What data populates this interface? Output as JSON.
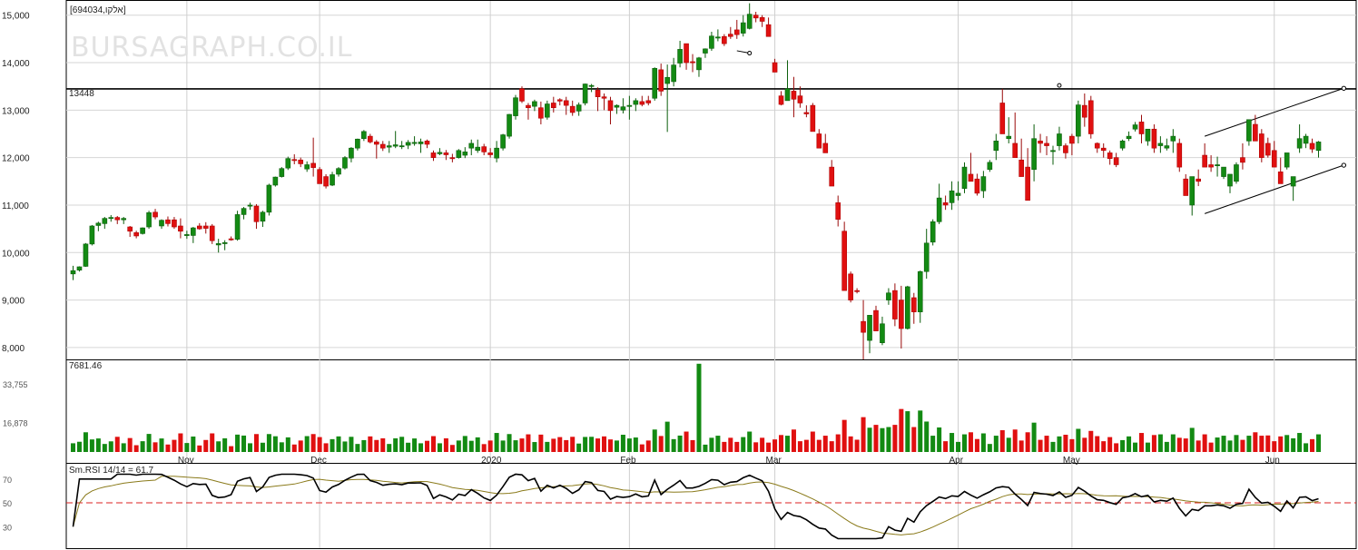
{
  "chart_data": {
    "type": "candlestick",
    "ticker_label": "[אלקו,694034]",
    "watermark": "BURSAGRAPH.CO.IL",
    "price_axis": {
      "ylim": [
        7750,
        15300
      ],
      "ticks": [
        8000,
        9000,
        10000,
        11000,
        12000,
        13000,
        14000,
        15000
      ],
      "tick_labels": [
        "8,000",
        "9,000",
        "10,000",
        "11,000",
        "12,000",
        "13,000",
        "14,000",
        "15,000"
      ]
    },
    "resistance": {
      "label": "13448",
      "value": 13448
    },
    "volume_axis": {
      "ymax": 40000,
      "ticks": [
        "33,755",
        "16,878"
      ],
      "tick_values": [
        33755,
        16878
      ],
      "label": "7681.46"
    },
    "rsi": {
      "label": "Sm.RSI 14/14 = 61.7",
      "ticks": [
        "70",
        "50",
        "30"
      ],
      "tick_values": [
        70,
        50,
        30
      ],
      "reference": 50,
      "ylim": [
        12,
        82
      ]
    },
    "x_months": [
      "Nov",
      "Dec",
      "2020",
      "Feb",
      "Mar",
      "Apr",
      "May",
      "Jun"
    ],
    "candles": [
      [
        9550,
        9720,
        9420,
        9620
      ],
      [
        9630,
        9710,
        9600,
        9700
      ],
      [
        9710,
        10200,
        9700,
        10180
      ],
      [
        10180,
        10580,
        10150,
        10560
      ],
      [
        10570,
        10650,
        10450,
        10620
      ],
      [
        10610,
        10750,
        10500,
        10720
      ],
      [
        10720,
        10790,
        10650,
        10740
      ],
      [
        10740,
        10770,
        10600,
        10690
      ],
      [
        10690,
        10750,
        10600,
        10720
      ],
      [
        10540,
        10560,
        10330,
        10450
      ],
      [
        10420,
        10460,
        10300,
        10350
      ],
      [
        10400,
        10530,
        10380,
        10520
      ],
      [
        10540,
        10880,
        10500,
        10840
      ],
      [
        10850,
        10920,
        10700,
        10750
      ],
      [
        10560,
        10700,
        10500,
        10680
      ],
      [
        10690,
        10760,
        10550,
        10610
      ],
      [
        10690,
        10750,
        10500,
        10540
      ],
      [
        10560,
        10720,
        10300,
        10450
      ],
      [
        10380,
        10460,
        10290,
        10380
      ],
      [
        10360,
        10540,
        10200,
        10520
      ],
      [
        10560,
        10620,
        10480,
        10500
      ],
      [
        10560,
        10640,
        10400,
        10510
      ],
      [
        10560,
        10600,
        10180,
        10250
      ],
      [
        10160,
        10290,
        10000,
        10190
      ],
      [
        10200,
        10260,
        10050,
        10210
      ],
      [
        10290,
        10340,
        10250,
        10280
      ],
      [
        10280,
        10880,
        10250,
        10800
      ],
      [
        10800,
        10960,
        10700,
        10930
      ],
      [
        10980,
        11050,
        10900,
        11000
      ],
      [
        10980,
        11020,
        10500,
        10650
      ],
      [
        10660,
        10880,
        10540,
        10850
      ],
      [
        10850,
        11450,
        10780,
        11420
      ],
      [
        11420,
        11600,
        11390,
        11590
      ],
      [
        11600,
        11800,
        11580,
        11770
      ],
      [
        11780,
        12020,
        11740,
        11980
      ],
      [
        11960,
        12070,
        11860,
        11940
      ],
      [
        11950,
        12000,
        11800,
        11870
      ],
      [
        11760,
        11920,
        11700,
        11850
      ],
      [
        11880,
        12420,
        11600,
        11790
      ],
      [
        11750,
        11800,
        11500,
        11450
      ],
      [
        11600,
        11650,
        11350,
        11400
      ],
      [
        11420,
        11700,
        11400,
        11640
      ],
      [
        11650,
        11800,
        11600,
        11770
      ],
      [
        11780,
        12030,
        11750,
        12000
      ],
      [
        11990,
        12220,
        11900,
        12200
      ],
      [
        12200,
        12400,
        12150,
        12390
      ],
      [
        12400,
        12580,
        12350,
        12550
      ],
      [
        12450,
        12500,
        12300,
        12330
      ],
      [
        12330,
        12370,
        11980,
        12280
      ],
      [
        12280,
        12350,
        12140,
        12200
      ],
      [
        12220,
        12350,
        12100,
        12250
      ],
      [
        12240,
        12560,
        12200,
        12270
      ],
      [
        12230,
        12350,
        12180,
        12250
      ],
      [
        12260,
        12370,
        12180,
        12320
      ],
      [
        12300,
        12450,
        12250,
        12320
      ],
      [
        12290,
        12400,
        12100,
        12330
      ],
      [
        12350,
        12380,
        12200,
        12280
      ],
      [
        12100,
        12150,
        11930,
        12000
      ],
      [
        12080,
        12200,
        12050,
        12110
      ],
      [
        12100,
        12160,
        11950,
        12060
      ],
      [
        12000,
        12080,
        11900,
        11990
      ],
      [
        12000,
        12180,
        11980,
        12150
      ],
      [
        12050,
        12220,
        11990,
        12120
      ],
      [
        12200,
        12380,
        12050,
        12300
      ],
      [
        12150,
        12380,
        12100,
        12220
      ],
      [
        12230,
        12290,
        12050,
        12120
      ],
      [
        12100,
        12200,
        12000,
        12060
      ],
      [
        11990,
        12350,
        11900,
        12200
      ],
      [
        12200,
        12500,
        12150,
        12480
      ],
      [
        12450,
        12920,
        12400,
        12910
      ],
      [
        12880,
        13320,
        12800,
        13260
      ],
      [
        13450,
        13500,
        13150,
        13190
      ],
      [
        13100,
        13150,
        12800,
        13050
      ],
      [
        13080,
        13220,
        12980,
        13180
      ],
      [
        13050,
        13180,
        12700,
        12830
      ],
      [
        12850,
        13200,
        12800,
        13130
      ],
      [
        13150,
        13280,
        12950,
        13050
      ],
      [
        13220,
        13250,
        13100,
        13190
      ],
      [
        13200,
        13280,
        12900,
        13100
      ],
      [
        13080,
        13200,
        12880,
        12950
      ],
      [
        12980,
        13160,
        12880,
        13110
      ],
      [
        13150,
        13560,
        13100,
        13550
      ],
      [
        13500,
        13550,
        13380,
        13520
      ],
      [
        13420,
        13480,
        12980,
        13280
      ],
      [
        13280,
        13350,
        13000,
        13250
      ],
      [
        13200,
        13280,
        12700,
        12990
      ],
      [
        13060,
        13120,
        12920,
        13100
      ],
      [
        13000,
        13250,
        12930,
        13070
      ],
      [
        13080,
        13300,
        12800,
        13100
      ],
      [
        13120,
        13250,
        12980,
        13200
      ],
      [
        13180,
        13300,
        13080,
        13120
      ],
      [
        13200,
        13300,
        13100,
        13150
      ],
      [
        13250,
        13900,
        13200,
        13880
      ],
      [
        13850,
        13980,
        13300,
        13400
      ],
      [
        13560,
        13960,
        12540,
        13690
      ],
      [
        13600,
        14100,
        13500,
        13950
      ],
      [
        13990,
        14460,
        13900,
        14280
      ],
      [
        14400,
        14400,
        13850,
        14000
      ],
      [
        14020,
        14180,
        13800,
        14000
      ],
      [
        13850,
        14120,
        13700,
        14100
      ],
      [
        14200,
        14300,
        14100,
        14290
      ],
      [
        14300,
        14650,
        14250,
        14560
      ],
      [
        14530,
        14700,
        14450,
        14540
      ],
      [
        14550,
        14600,
        14350,
        14400
      ],
      [
        14600,
        14750,
        14500,
        14550
      ],
      [
        14690,
        14900,
        14500,
        14590
      ],
      [
        14620,
        15000,
        14550,
        14840
      ],
      [
        14720,
        15250,
        14700,
        15020
      ],
      [
        15000,
        15070,
        14850,
        14940
      ],
      [
        14950,
        15000,
        14750,
        14870
      ],
      [
        14800,
        14950,
        14600,
        14550
      ],
      [
        14000,
        14080,
        13800,
        13800
      ],
      [
        13300,
        13400,
        13100,
        13120
      ],
      [
        13200,
        14050,
        13350,
        13450
      ],
      [
        13400,
        13700,
        12850,
        13230
      ],
      [
        13300,
        13500,
        13050,
        13150
      ],
      [
        12950,
        13100,
        12850,
        12920
      ],
      [
        13100,
        13150,
        12600,
        12550
      ],
      [
        12500,
        12600,
        12200,
        12200
      ],
      [
        12300,
        12500,
        12100,
        12100
      ],
      [
        11800,
        11950,
        11500,
        11400
      ],
      [
        11050,
        11200,
        10550,
        10700
      ],
      [
        10450,
        10650,
        9250,
        9200
      ],
      [
        9550,
        9600,
        8950,
        9000
      ],
      [
        9200,
        9250,
        9140,
        9180
      ],
      [
        8550,
        9000,
        7750,
        8320
      ],
      [
        8150,
        8350,
        7880,
        8680
      ],
      [
        8780,
        8880,
        8580,
        8350
      ],
      [
        8100,
        8650,
        8050,
        8500
      ],
      [
        9000,
        9250,
        8900,
        9150
      ],
      [
        9200,
        9350,
        8450,
        8600
      ],
      [
        9000,
        9300,
        7980,
        8400
      ],
      [
        8400,
        9300,
        8380,
        9280
      ],
      [
        9050,
        9150,
        8500,
        8750
      ],
      [
        8750,
        9620,
        8520,
        9600
      ],
      [
        9600,
        10500,
        9450,
        10200
      ],
      [
        10220,
        10700,
        10150,
        10650
      ],
      [
        10650,
        11450,
        10600,
        11150
      ],
      [
        11050,
        11200,
        10900,
        11000
      ],
      [
        11050,
        11500,
        10900,
        11300
      ],
      [
        11200,
        11500,
        11100,
        11250
      ],
      [
        11350,
        11900,
        11250,
        11800
      ],
      [
        11650,
        12100,
        11600,
        11500
      ],
      [
        11550,
        11660,
        11200,
        11250
      ],
      [
        11300,
        11720,
        11150,
        11600
      ],
      [
        11750,
        11950,
        11700,
        11900
      ],
      [
        12150,
        12500,
        11950,
        12350
      ],
      [
        13150,
        13450,
        12800,
        12500
      ],
      [
        12400,
        12850,
        12300,
        12450
      ],
      [
        12300,
        12950,
        12100,
        12000
      ],
      [
        11950,
        12400,
        11900,
        11600
      ],
      [
        11800,
        12200,
        11400,
        11100
      ],
      [
        11750,
        12700,
        11500,
        12400
      ],
      [
        12350,
        12500,
        12100,
        12300
      ],
      [
        12300,
        12450,
        12050,
        12250
      ],
      [
        12150,
        12250,
        11850,
        12150
      ],
      [
        12250,
        12650,
        12150,
        12500
      ],
      [
        12250,
        12300,
        11980,
        12100
      ],
      [
        12450,
        12500,
        12050,
        12300
      ],
      [
        12450,
        13200,
        12300,
        13110
      ],
      [
        13100,
        13350,
        12650,
        12850
      ],
      [
        13200,
        13300,
        12400,
        12500
      ],
      [
        12300,
        12320,
        12100,
        12200
      ],
      [
        12200,
        12300,
        12000,
        12150
      ],
      [
        12100,
        12150,
        11850,
        11980
      ],
      [
        12000,
        12100,
        11800,
        11850
      ],
      [
        12200,
        12380,
        12150,
        12350
      ],
      [
        12400,
        12550,
        12350,
        12450
      ],
      [
        12600,
        12750,
        12550,
        12690
      ],
      [
        12750,
        12900,
        12300,
        12500
      ],
      [
        12350,
        12600,
        12250,
        12600
      ],
      [
        12600,
        12700,
        12100,
        12200
      ],
      [
        12250,
        12450,
        12100,
        12300
      ],
      [
        12200,
        12400,
        12150,
        12250
      ],
      [
        12350,
        12600,
        12100,
        12450
      ],
      [
        12300,
        12400,
        11700,
        11800
      ],
      [
        11550,
        11650,
        11300,
        11200
      ],
      [
        11000,
        11600,
        10780,
        11600
      ],
      [
        11550,
        11750,
        11400,
        11500
      ],
      [
        12050,
        12300,
        11800,
        11800
      ],
      [
        11850,
        12050,
        11700,
        11800
      ],
      [
        11850,
        12020,
        11600,
        11850
      ],
      [
        11600,
        11800,
        11550,
        11800
      ],
      [
        11400,
        11600,
        11250,
        11650
      ],
      [
        11500,
        11900,
        11450,
        11850
      ],
      [
        12000,
        12300,
        11750,
        11900
      ],
      [
        12350,
        12800,
        12250,
        12800
      ],
      [
        12700,
        12900,
        12400,
        12350
      ],
      [
        12500,
        12600,
        11900,
        12000
      ],
      [
        12300,
        12420,
        12000,
        12050
      ],
      [
        12150,
        12350,
        11900,
        11800
      ],
      [
        11700,
        12000,
        11500,
        11450
      ],
      [
        11800,
        12050,
        11750,
        12100
      ],
      [
        11400,
        11600,
        11090,
        11600
      ],
      [
        12200,
        12700,
        12100,
        12400
      ],
      [
        12300,
        12500,
        12200,
        12450
      ],
      [
        12300,
        12400,
        12100,
        12180
      ],
      [
        12150,
        12350,
        12000,
        12330
      ]
    ]
  }
}
